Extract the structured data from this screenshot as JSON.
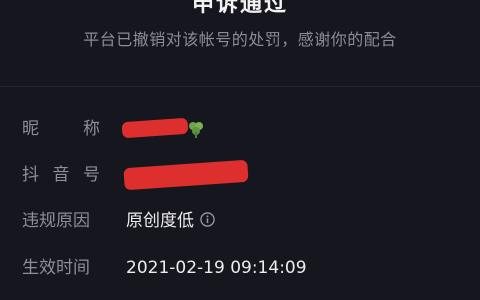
{
  "header": {
    "title": "申诉通过",
    "subtitle": "平台已撤销对该帐号的处罚，感谢你的配合"
  },
  "details": {
    "nickname": {
      "label_chars": [
        "昵",
        "称"
      ],
      "value": ""
    },
    "douyin_id": {
      "label_chars": [
        "抖",
        "音",
        "号"
      ],
      "value": ""
    },
    "reason": {
      "label": "违规原因",
      "value": "原创度低"
    },
    "effective_time": {
      "label": "生效时间",
      "value": "2021-02-19 09:14:09"
    }
  },
  "icons": {
    "info": "info-icon",
    "leaf": "clover-icon"
  },
  "colors": {
    "background": "#16161e",
    "label": "#8e8e98",
    "value": "#ececf0",
    "redaction": "#e8302e"
  }
}
